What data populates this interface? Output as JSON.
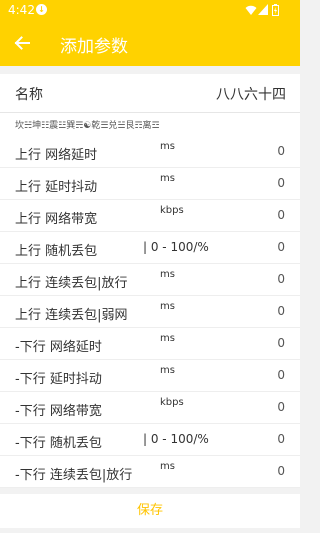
{
  "status_bar": {
    "time": "4:42",
    "download_glyph": "↓",
    "icons": [
      "download-icon",
      "wifi-icon",
      "signal-icon",
      "battery-icon"
    ]
  },
  "app_bar": {
    "title": "添加参数",
    "back_icon": "arrow-left-icon"
  },
  "name_field": {
    "label": "名称",
    "value": "八八六十四"
  },
  "gua_line": "坎☵坤☷震☳巽☴☯乾☰兑☱艮☶离☲",
  "params": [
    {
      "label": "上行 网络延时",
      "unit": "ms",
      "value": "0"
    },
    {
      "label": "上行 延时抖动",
      "unit": "ms",
      "value": "0"
    },
    {
      "label": "上行 网络带宽",
      "unit": "kbps",
      "value": "0"
    },
    {
      "label": "上行 随机丢包",
      "unit": "| 0 - 100/%",
      "value": "0"
    },
    {
      "label": "上行 连续丢包|放行",
      "unit": "ms",
      "value": "0"
    },
    {
      "label": "上行 连续丢包|弱网",
      "unit": "ms",
      "value": "0"
    },
    {
      "label": "-下行 网络延时",
      "unit": "ms",
      "value": "0"
    },
    {
      "label": "-下行 延时抖动",
      "unit": "ms",
      "value": "0"
    },
    {
      "label": "-下行 网络带宽",
      "unit": "kbps",
      "value": "0"
    },
    {
      "label": "-下行 随机丢包",
      "unit": "| 0 - 100/%",
      "value": "0"
    },
    {
      "label": "-下行 连续丢包|放行",
      "unit": "ms",
      "value": "0"
    }
  ],
  "save_button": {
    "label": "保存"
  },
  "colors": {
    "accent": "#ffd200",
    "save_text": "#ffc400",
    "background": "#f2f2f2"
  }
}
